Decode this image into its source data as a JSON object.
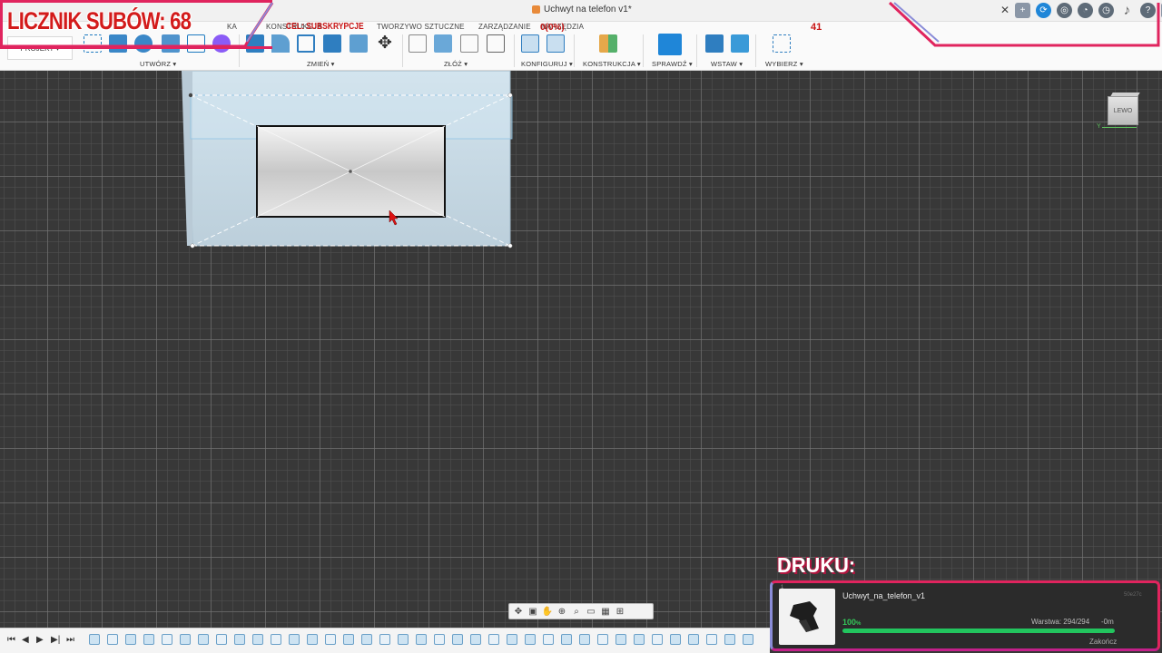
{
  "window": {
    "title": "Uchwyt na telefon v1*"
  },
  "ribbon": {
    "tabs": [
      "KONSTRUKCJA",
      "TWORZYWO SZTUCZNE",
      "ZARZĄDZANIE",
      "NARZĘDZIA"
    ],
    "tab_partial_left": "KA",
    "workspace": "PROJEKT",
    "groups": {
      "create": "UTWÓRZ",
      "modify": "ZMIEŃ",
      "assemble": "ZŁÓŻ",
      "configure": "KONFIGURUJ",
      "construct": "KONSTRUKCJA",
      "inspect": "SPRAWDŹ",
      "insert": "WSTAW",
      "select": "WYBIERZ"
    }
  },
  "overlay": {
    "sub_counter": "LICZNIK SUBÓW: 68",
    "goal_label": "CEL: SUBSKRYPCJE",
    "goal_percent": "0(0%)",
    "goal_target": "41"
  },
  "viewcube": {
    "face_label": "LEWO",
    "axis_label": "Y"
  },
  "print_status": {
    "heading": "DRUKU:",
    "slot": "1",
    "file_name": "Uchwyt_na_telefon_v1",
    "extra": "50e27c",
    "percent": "100",
    "percent_unit": "%",
    "progress": 1.0,
    "layers": "Warstwa: 294/294",
    "time_left": "-0m",
    "finish_label": "Zakończ"
  },
  "colors": {
    "accent": "#e0245e",
    "counter_red": "#d31b1b",
    "progress_green": "#22c55e",
    "model_face": "#c5d8e4",
    "viewport_bg": "#383838"
  },
  "icons": {
    "title_cube": "cube-icon",
    "close_tab": "close-icon",
    "new_tab": "plus-icon",
    "move": "move-icon"
  }
}
